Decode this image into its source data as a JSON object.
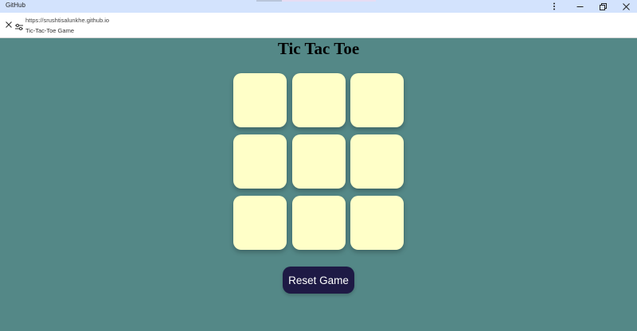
{
  "window": {
    "app_name": "GitHub",
    "menu_icon": "vertical-dots-icon",
    "minimize_icon": "minimize-icon",
    "restore_icon": "restore-icon",
    "close_icon": "close-icon"
  },
  "address_bar": {
    "url": "https://srushtisalunkhe.github.io",
    "page_title": "Tic-Tac-Toe Game",
    "close_icon": "close-icon",
    "site_settings_icon": "tune-icon"
  },
  "game": {
    "title": "Tic Tac Toe",
    "cells": [
      "",
      "",
      "",
      "",
      "",
      "",
      "",
      "",
      ""
    ],
    "reset_label": "Reset Game"
  },
  "colors": {
    "background": "#548887",
    "cell": "#ffffc8",
    "button": "#1e1a45",
    "titlebar": "#d3e3fd"
  }
}
